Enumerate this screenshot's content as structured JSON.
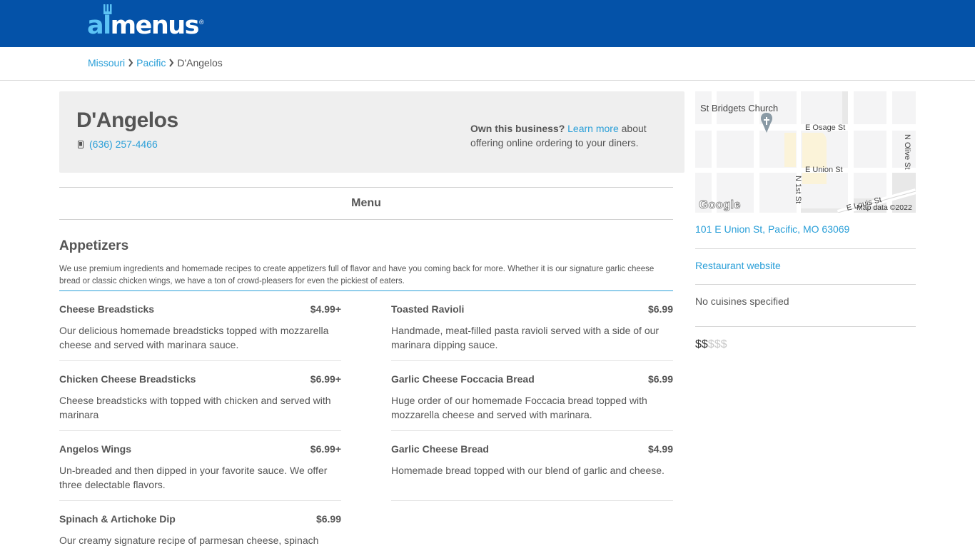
{
  "header": {
    "logo_prefix": "al",
    "logo_main": "menus",
    "logo_reg": "®",
    "bg_color": "#0452a8"
  },
  "breadcrumb": {
    "items": [
      {
        "label": "Missouri"
      },
      {
        "label": "Pacific"
      }
    ],
    "current": "D'Angelos"
  },
  "restaurant": {
    "name": "D'Angelos",
    "phone": "(636) 257-4466",
    "own_bold": "Own this business?",
    "own_link": "Learn more",
    "own_rest": " about offering online ordering to your diners."
  },
  "tabs": {
    "menu": "Menu"
  },
  "section": {
    "title": "Appetizers",
    "description": "We use premium ingredients and homemade recipes to create appetizers full of flavor and have you coming back for more. Whether it is our signature garlic cheese bread or classic chicken wings, we have a ton of crowd-pleasers for even the pickiest of eaters.",
    "items": [
      {
        "name": "Cheese Breadsticks",
        "price": "$4.99+",
        "desc": "Our delicious homemade breadsticks topped with mozzarella cheese and served with marinara sauce."
      },
      {
        "name": "Toasted Ravioli",
        "price": "$6.99",
        "desc": "Handmade, meat-filled pasta ravioli served with a side of our marinara dipping sauce."
      },
      {
        "name": "Chicken Cheese Breadsticks",
        "price": "$6.99+",
        "desc": "Cheese breadsticks with topped with chicken and served with marinara"
      },
      {
        "name": "Garlic Cheese Foccacia Bread",
        "price": "$6.99",
        "desc": "Huge order of our homemade Foccacia bread topped with mozzarella cheese and served with marinara."
      },
      {
        "name": "Angelos Wings",
        "price": "$6.99+",
        "desc": "Un-breaded and then dipped in your favorite sauce. We offer three delectable flavors."
      },
      {
        "name": "Garlic Cheese Bread",
        "price": "$4.99",
        "desc": "Homemade bread topped with our blend of garlic and cheese."
      },
      {
        "name": "Spinach & Artichoke Dip",
        "price": "$6.99",
        "desc": "Our creamy signature recipe of parmesan cheese, spinach"
      }
    ]
  },
  "map": {
    "labels": {
      "church": "St Bridgets Church",
      "osage": "E Osage St",
      "union": "E Union St",
      "first": "N 1st St",
      "olive": "N Olive St",
      "louis": "E Louis St",
      "google": "Google",
      "attribution": "Map data ©2022"
    }
  },
  "sidebar": {
    "address": "101 E Union St, Pacific, MO 63069",
    "website": "Restaurant website",
    "cuisines": "No cuisines specified",
    "price_on": "$$",
    "price_off": "$$$",
    "price_level": 2,
    "price_max": 5
  }
}
